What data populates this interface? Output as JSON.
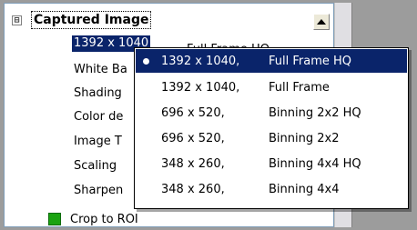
{
  "property_grid": {
    "group": {
      "expander_symbol": "⊟",
      "title": "Captured Image"
    },
    "selected_value_partial": "Full Frame HQ",
    "properties": [
      {
        "label": "1392 x 1040",
        "selected": true
      },
      {
        "label": "White Ba"
      },
      {
        "label": "Shading"
      },
      {
        "label": "Color de"
      },
      {
        "label": "Image T"
      },
      {
        "label": "Scaling"
      },
      {
        "label": "Sharpen"
      },
      {
        "label": "Crop to ROI",
        "swatch_color": "#1aa310"
      }
    ]
  },
  "dropdown": {
    "selected_index": 0,
    "options": [
      {
        "resolution": "1392 x 1040,",
        "mode": "Full Frame HQ"
      },
      {
        "resolution": "1392 x 1040,",
        "mode": "Full Frame"
      },
      {
        "resolution": "696 x 520,",
        "mode": "Binning 2x2 HQ"
      },
      {
        "resolution": "696 x 520,",
        "mode": "Binning 2x2"
      },
      {
        "resolution": "348 x 260,",
        "mode": "Binning 4x4 HQ"
      },
      {
        "resolution": "348 x 260,",
        "mode": "Binning 4x4"
      }
    ]
  },
  "colors": {
    "selection": "#0a246a",
    "background_gray": "#9c9c9c"
  }
}
